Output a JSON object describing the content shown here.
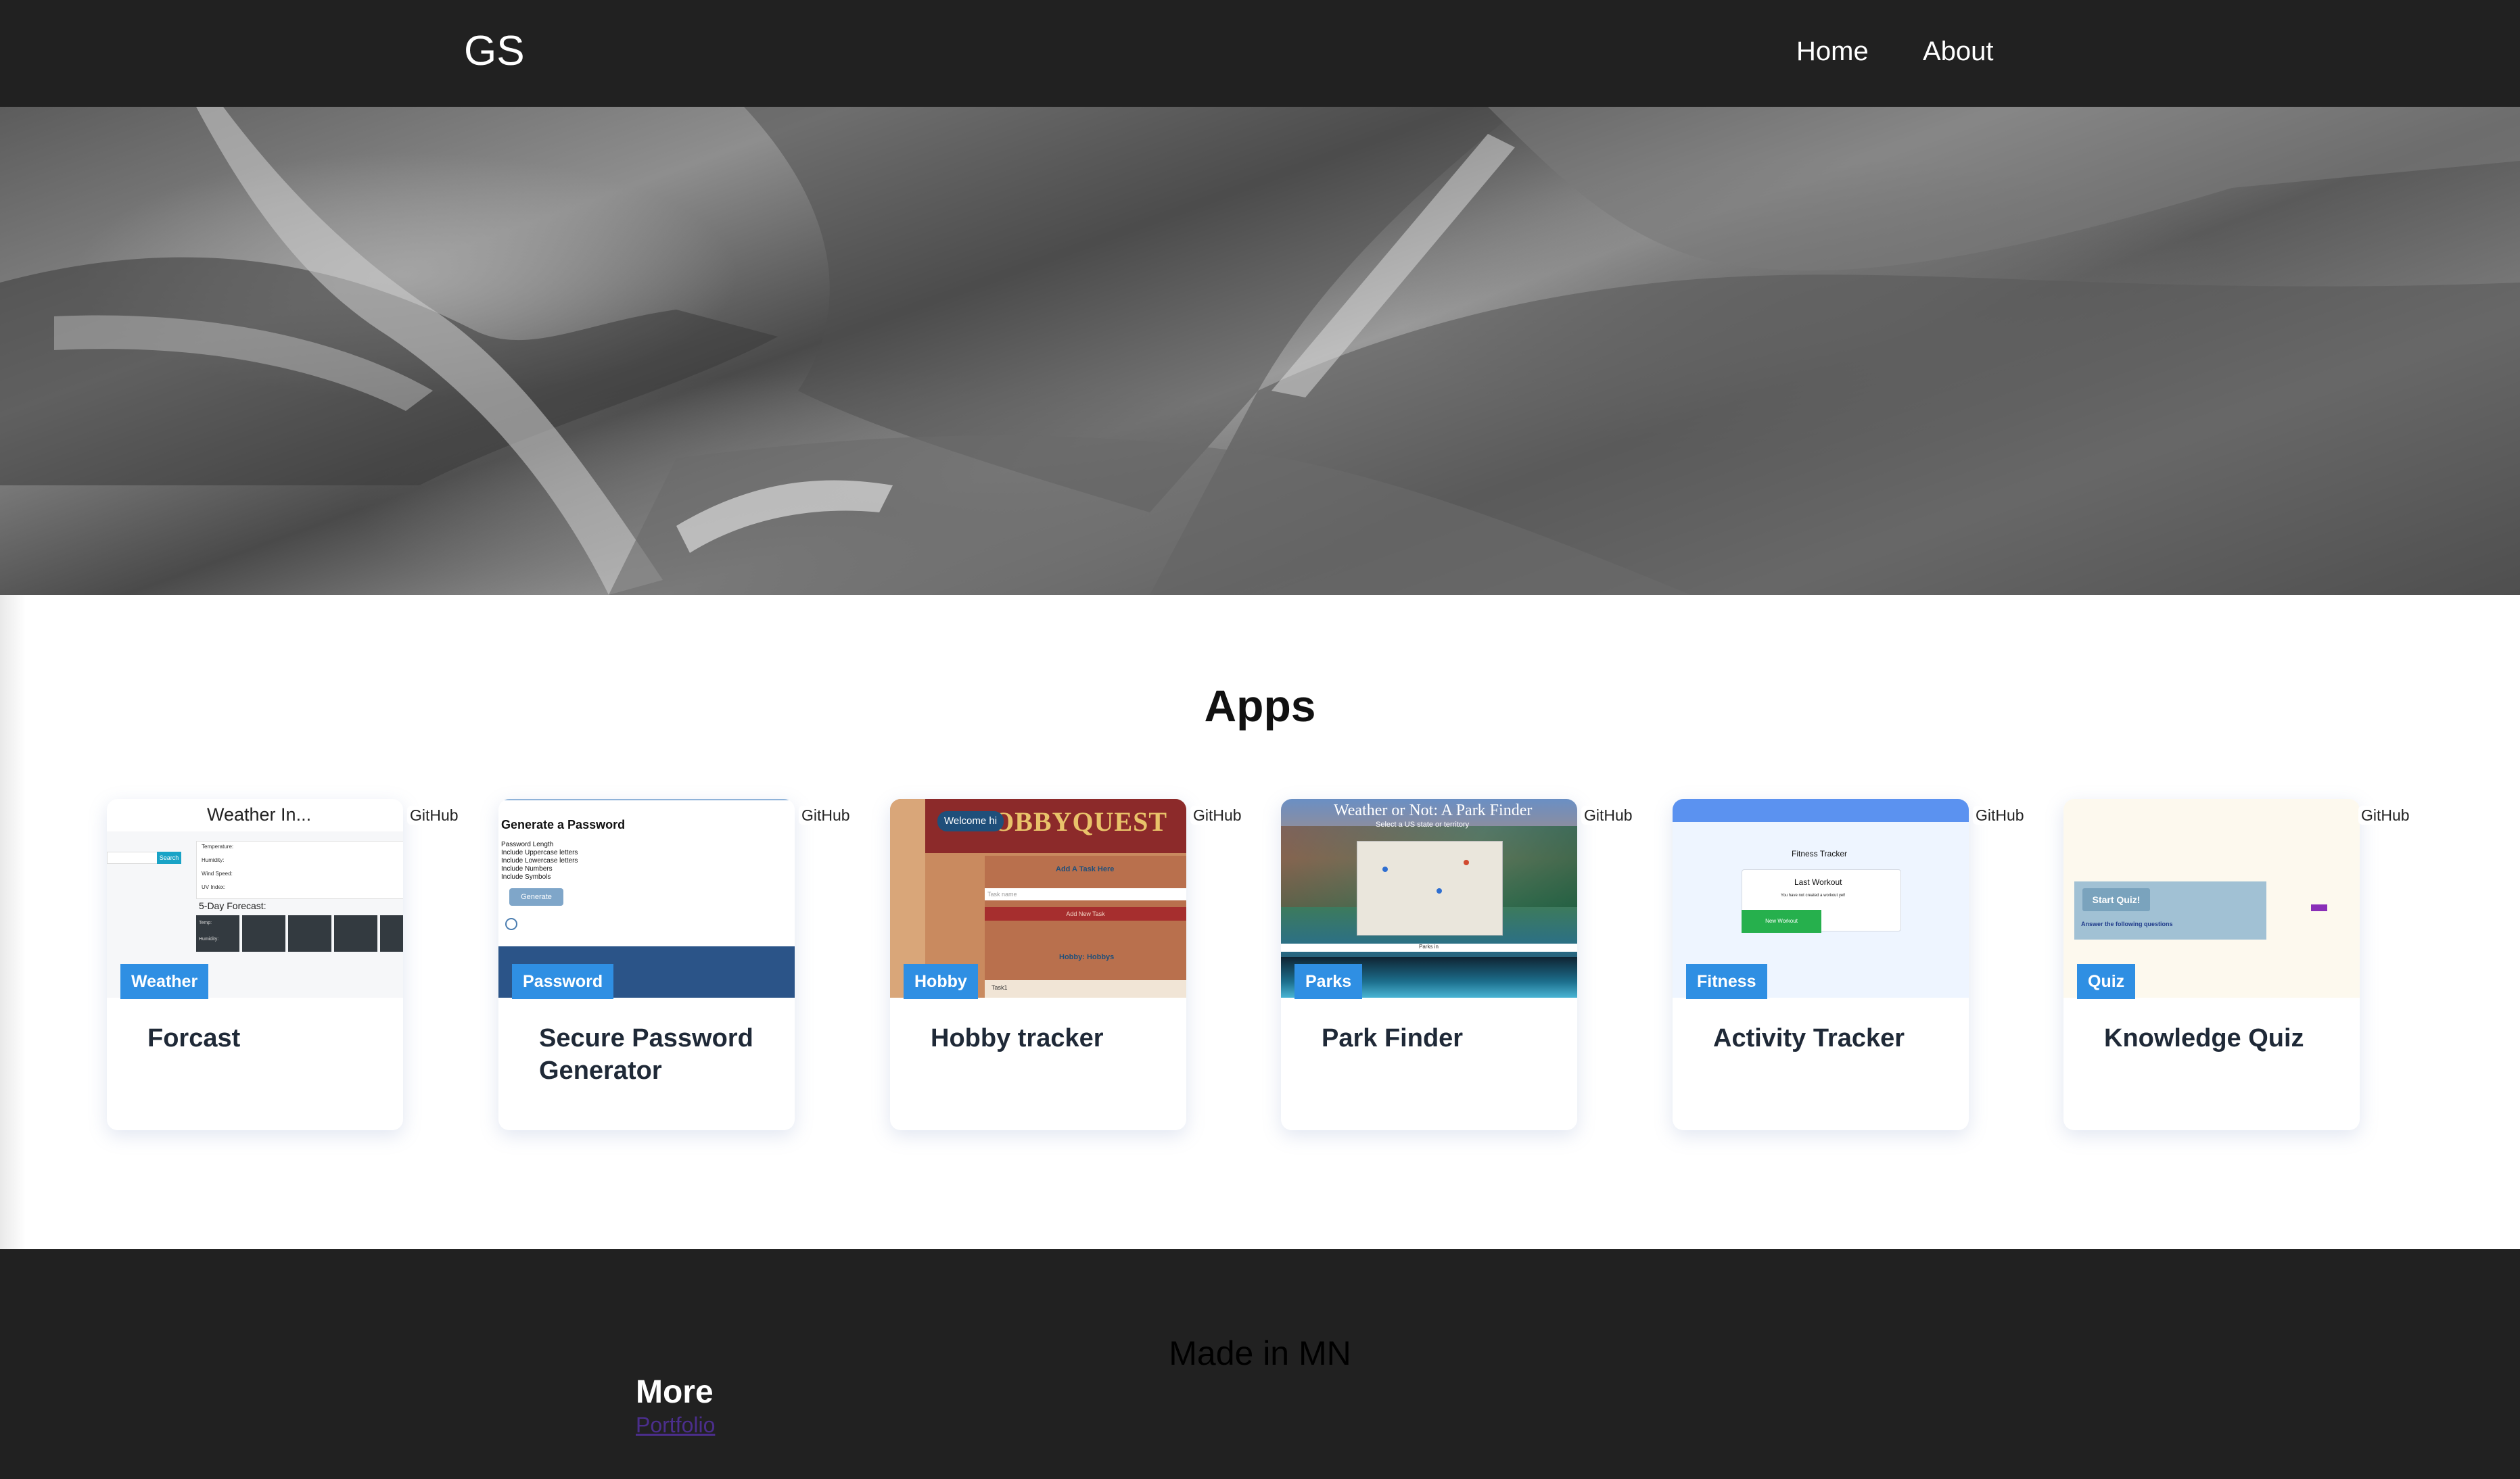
{
  "header": {
    "logo": "GS",
    "nav": [
      {
        "label": "Home"
      },
      {
        "label": "About"
      }
    ]
  },
  "main": {
    "section_title": "Apps",
    "cards": [
      {
        "tag": "Weather",
        "title": "Forcast",
        "github": "GitHub",
        "thumb": {
          "heading": "Weather In...",
          "button": "Search",
          "rows": [
            "Temperature:",
            "Humidity:",
            "Wind Speed:",
            "UV Index:"
          ],
          "forecast": "5-Day Forecast:",
          "cell_a": "Temp:",
          "cell_b": "Humidity:"
        }
      },
      {
        "tag": "Password",
        "title": "Secure Password Generator",
        "github": "GitHub",
        "thumb": {
          "heading": "Generate a Password",
          "rows": [
            "Password Length",
            "Include Uppercase letters",
            "Include Lowercase letters",
            "Include Numbers",
            "Include Symbols"
          ],
          "button": "Generate"
        }
      },
      {
        "tag": "Hobby",
        "title": "Hobby tracker",
        "github": "GitHub",
        "thumb": {
          "banner": "HOBBYQUEST",
          "welcome": "Welcome hi",
          "add": "Add A Task Here",
          "placeholder": "Task name",
          "add_button": "Add New Task",
          "list": "Hobby: Hobbys",
          "row": "Task1"
        }
      },
      {
        "tag": "Parks",
        "title": "Park Finder",
        "github": "GitHub",
        "thumb": {
          "heading": "Weather or Not: A Park Finder",
          "sub": "Select a US state or territory",
          "caption": "Parks in"
        }
      },
      {
        "tag": "Fitness",
        "title": "Activity Tracker",
        "github": "GitHub",
        "thumb": {
          "heading": "Fitness Tracker",
          "box_title": "Last Workout",
          "box_text": "You have not created a workout yet!",
          "button": "New Workout"
        }
      },
      {
        "tag": "Quiz",
        "title": "Knowledge Quiz",
        "github": "GitHub",
        "thumb": {
          "button": "Start Quiz!",
          "text": "Answer the following questions"
        }
      }
    ]
  },
  "footer": {
    "made": "Made in MN",
    "more_heading": "More",
    "link": "Portfolio"
  },
  "colors": {
    "bar": "#212121",
    "tag": "#2f8fe3",
    "link_visited": "#4b2e8c"
  }
}
